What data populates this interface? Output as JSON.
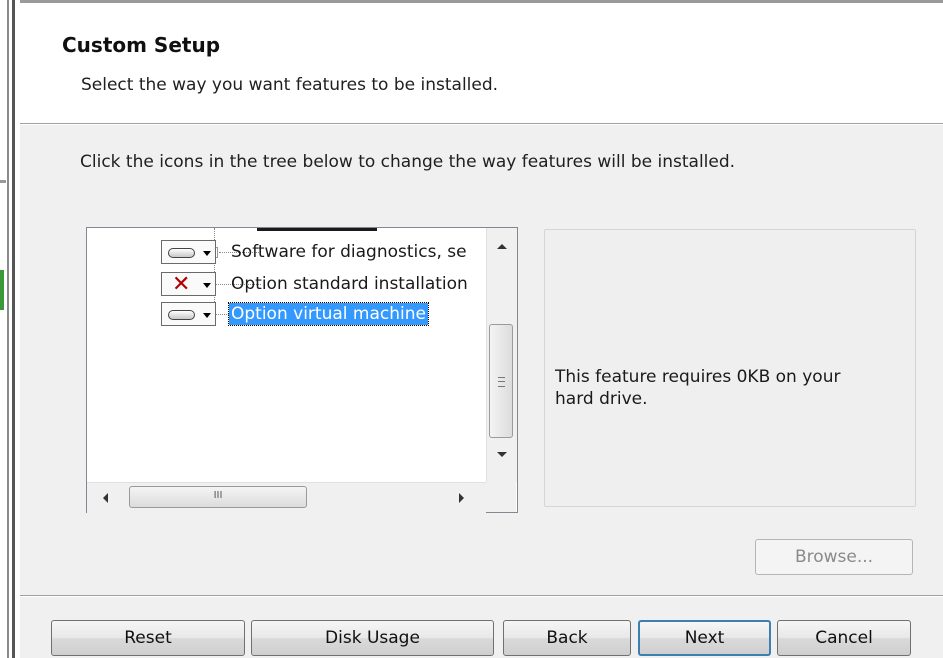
{
  "header": {
    "title": "Custom Setup",
    "subtitle": "Select the way you want features to be installed."
  },
  "instruction": "Click the icons in the tree below to change the way features will be installed.",
  "tree": {
    "items": [
      {
        "label": "Software for diagnostics, se",
        "icon": "hard-drive-icon",
        "expandable": true,
        "selected": false
      },
      {
        "label": "Option standard installation",
        "icon": "red-x-icon",
        "expandable": false,
        "selected": false
      },
      {
        "label": "Option virtual machine",
        "icon": "hard-drive-icon",
        "expandable": false,
        "selected": true
      }
    ],
    "hscroll_grip": "III"
  },
  "info": {
    "text": "This feature requires 0KB on your hard drive."
  },
  "buttons": {
    "browse": "Browse...",
    "reset": "Reset",
    "disk_usage": "Disk Usage",
    "back": "Back",
    "next": "Next",
    "cancel": "Cancel"
  },
  "colors": {
    "selection": "#3399ff",
    "x_mark": "#b00000",
    "default_button_border": "#3c7fb1"
  }
}
